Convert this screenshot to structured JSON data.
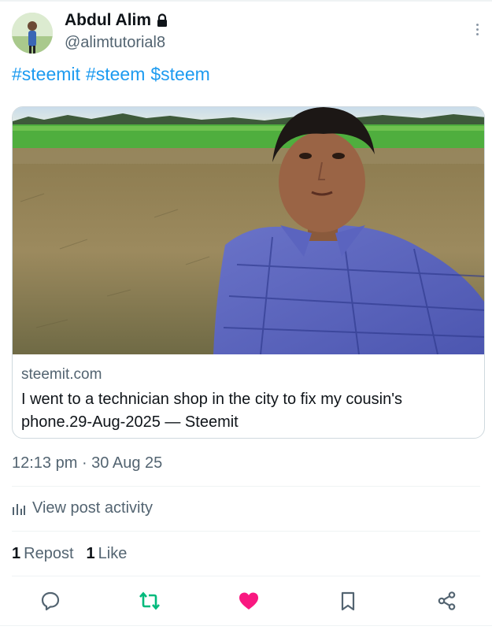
{
  "author": {
    "name": "Abdul Alim",
    "handle": "@alimtutorial8"
  },
  "post": {
    "hashtags": [
      "#steemit",
      "#steem",
      "$steem"
    ],
    "timestamp": "12:13 pm · 30 Aug 25"
  },
  "link_card": {
    "domain": "steemit.com",
    "title": "I went to a technician shop in the city to fix my cousin's phone.29-Aug-2025 — Steemit"
  },
  "activity": {
    "label": "View post activity"
  },
  "stats": {
    "reposts_count": "1",
    "reposts_label": "Repost",
    "likes_count": "1",
    "likes_label": "Like"
  },
  "actions": {
    "reply_icon": "reply-icon",
    "repost_icon": "repost-icon",
    "like_icon": "heart-icon",
    "bookmark_icon": "bookmark-icon",
    "share_icon": "share-icon"
  },
  "colors": {
    "link": "#1d9bf0",
    "muted": "#536471",
    "repost_active": "#00ba7c",
    "like_active": "#f91880"
  }
}
